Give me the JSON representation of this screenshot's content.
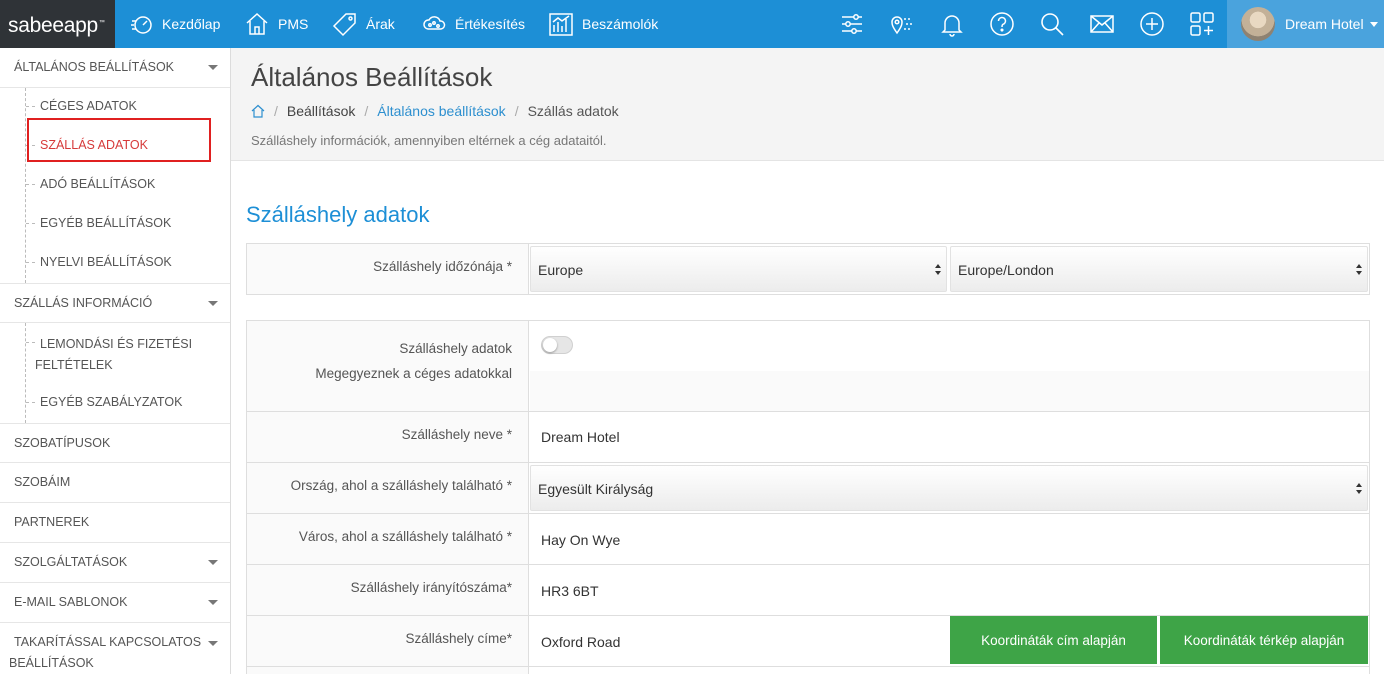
{
  "topbar": {
    "logo": "sabeeapp",
    "logo_tm": "™",
    "nav": [
      {
        "label": "Kezdőlap",
        "icon": "dashboard-icon"
      },
      {
        "label": "PMS",
        "icon": "home-icon"
      },
      {
        "label": "Árak",
        "icon": "price-tag-icon"
      },
      {
        "label": "Értékesítés",
        "icon": "cloud-network-icon"
      },
      {
        "label": "Beszámolók",
        "icon": "bar-chart-icon"
      }
    ],
    "tools": [
      "sliders-icon",
      "location-icon",
      "bell-icon",
      "help-icon",
      "search-icon",
      "mail-icon",
      "plus-icon",
      "apps-icon"
    ],
    "user_name": "Dream Hotel"
  },
  "sidebar": {
    "sections": [
      {
        "label": "ÁLTALÁNOS BEÁLLÍTÁSOK",
        "expandable": true
      },
      {
        "label": "SZÁLLÁS INFORMÁCIÓ",
        "expandable": true
      },
      {
        "label": "SZOBATÍPUSOK",
        "expandable": false
      },
      {
        "label": "SZOBÁIM",
        "expandable": false
      },
      {
        "label": "PARTNEREK",
        "expandable": false
      },
      {
        "label": "SZOLGÁLTATÁSOK",
        "expandable": true
      },
      {
        "label": "E-MAIL SABLONOK",
        "expandable": true
      },
      {
        "label": "TAKARÍTÁSSAL KAPCSOLATOS",
        "label_line2": "BEÁLLÍTÁSOK",
        "expandable": true
      }
    ],
    "general_items": [
      "CÉGES ADATOK",
      "SZÁLLÁS ADATOK",
      "ADÓ BEÁLLÍTÁSOK",
      "EGYÉB BEÁLLÍTÁSOK",
      "NYELVI BEÁLLÍTÁSOK"
    ],
    "accommodation_items": [
      {
        "label": "LEMONDÁSI ÉS FIZETÉSI",
        "label_line2": "FELTÉTELEK"
      },
      {
        "label": "EGYÉB SZABÁLYZATOK"
      }
    ],
    "active_item": "SZÁLLÁS ADATOK"
  },
  "page": {
    "title": "Általános Beállítások",
    "breadcrumb": [
      "Beállítások",
      "Általános beállítások",
      "Szállás adatok"
    ],
    "description": "Szálláshely információk, amennyiben eltérnek a cég adataitól."
  },
  "form": {
    "section_title": "Szálláshely adatok",
    "timezone_label": "Szálláshely időzónája *",
    "timezone_region": "Europe",
    "timezone_city": "Europe/London",
    "same_data_label_1": "Szálláshely adatok",
    "same_data_label_2": "Megegyeznek a céges adatokkal",
    "same_data_toggle": false,
    "name_label": "Szálláshely neve *",
    "name_value": "Dream Hotel",
    "country_label": "Ország, ahol a szálláshely található *",
    "country_value": "Egyesült Királyság",
    "city_label": "Város, ahol a szálláshely található *",
    "city_value": "Hay On Wye",
    "zip_label": "Szálláshely irányítószáma*",
    "zip_value": "HR3 6BT",
    "address_label": "Szálláshely címe*",
    "address_value": "Oxford Road",
    "btn_coords_address": "Koordináták cím alapján",
    "btn_coords_map": "Koordináták térkép alapján"
  }
}
